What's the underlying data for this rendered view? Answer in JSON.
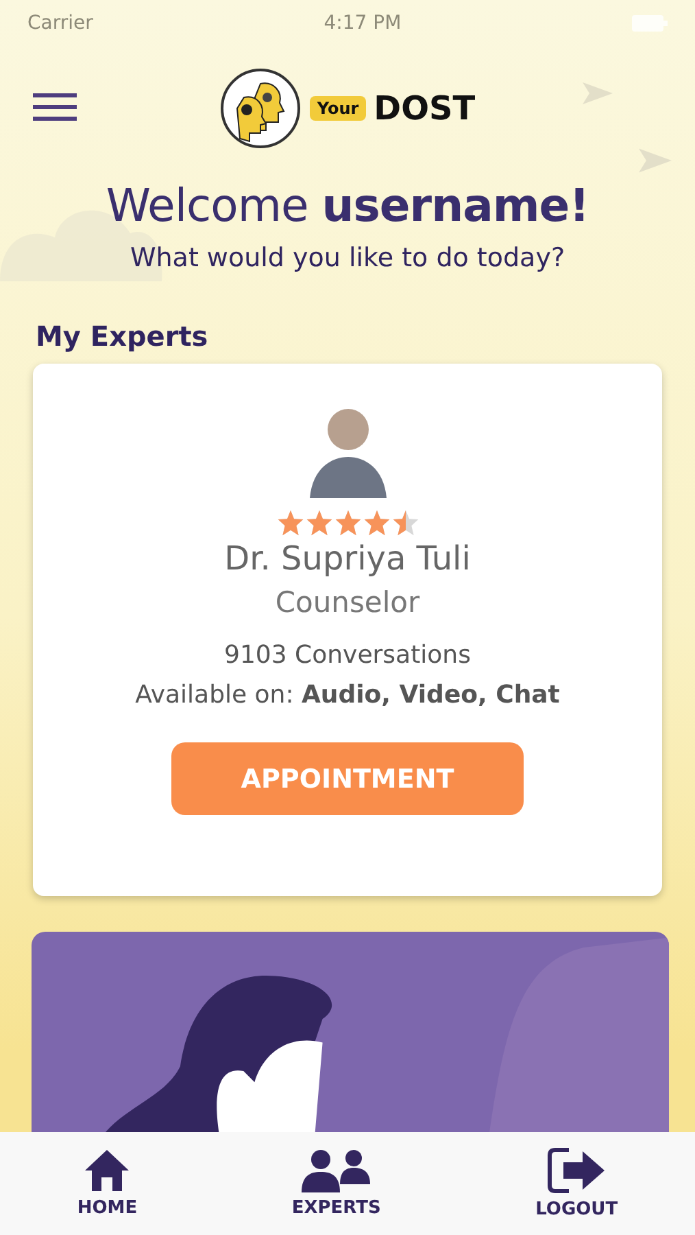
{
  "status_bar": {
    "carrier": "Carrier",
    "time": "4:17 PM"
  },
  "header": {
    "logo_badge": "Your",
    "logo_word": "DOST"
  },
  "welcome": {
    "title": "Welcome **username!**",
    "subtitle": "What would you like to do today?"
  },
  "section_title": "My Experts",
  "expert": {
    "stars": 4.5,
    "name": "Dr. Supriya Tuli",
    "role": "Counselor",
    "conversations": "9103 Conversations",
    "availability": "Available on: **Audio, Video, Chat**",
    "button": "APPOINTMENT"
  },
  "nav": [
    {
      "label": "HOME",
      "kind": "home"
    },
    {
      "label": "EXPERTS",
      "kind": "experts"
    },
    {
      "label": "LOGOUT",
      "kind": "logout"
    }
  ]
}
